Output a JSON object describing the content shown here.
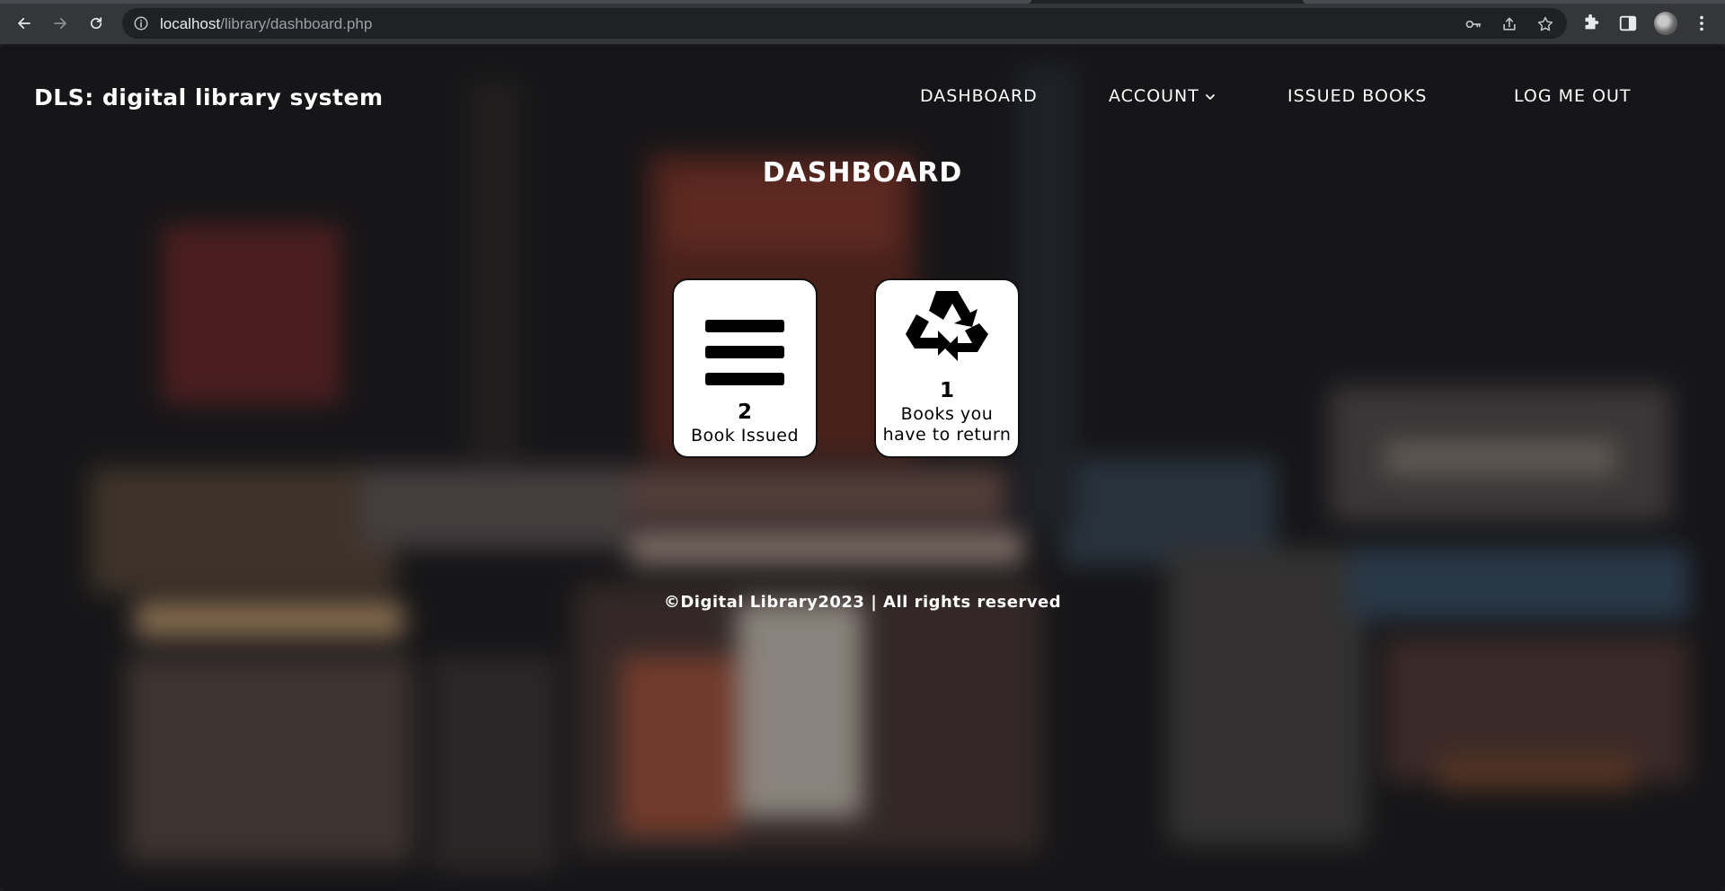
{
  "browser": {
    "url_host": "localhost",
    "url_path": "/library/dashboard.php"
  },
  "site": {
    "brand": "DLS: digital library system"
  },
  "nav": {
    "dashboard": "DASHBOARD",
    "account": "ACCOUNT",
    "issued_books": "ISSUED BOOKS",
    "logout": "LOG ME OUT"
  },
  "main": {
    "title": "DASHBOARD",
    "cards": [
      {
        "icon": "menu-bars-icon",
        "count": "2",
        "label": "Book Issued"
      },
      {
        "icon": "recycle-icon",
        "count": "1",
        "label_line1": "Books you",
        "label_line2": "have to return"
      }
    ]
  },
  "footer": {
    "text": "©Digital Library2023 | All rights reserved"
  },
  "colors": {
    "chrome_bg": "#35363a",
    "omnibox_bg": "#202124",
    "text_white": "#ffffff",
    "card_bg": "#ffffff"
  }
}
